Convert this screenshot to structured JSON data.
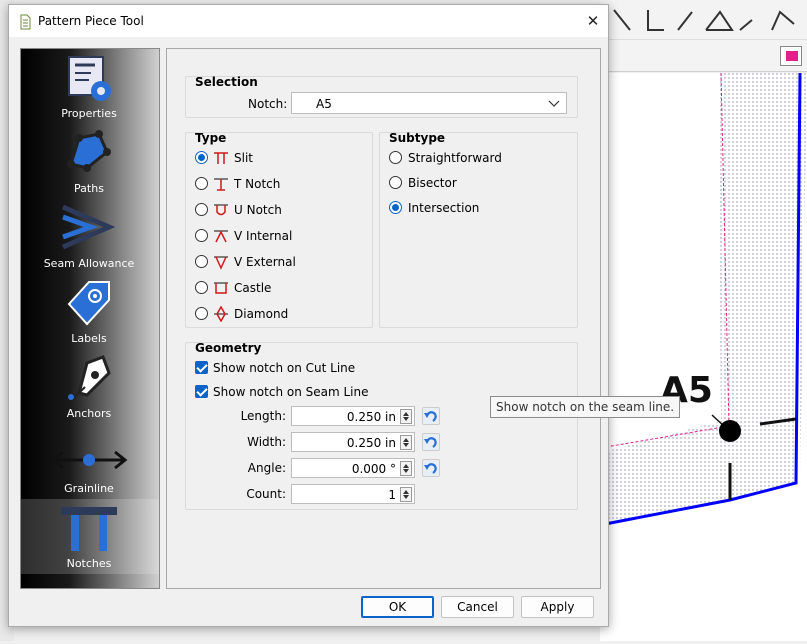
{
  "dialog": {
    "title": "Pattern Piece Tool"
  },
  "sidebar": {
    "items": [
      {
        "label": "Properties",
        "icon": "properties-icon"
      },
      {
        "label": "Paths",
        "icon": "paths-icon"
      },
      {
        "label": "Seam Allowance",
        "icon": "seam-allowance-icon"
      },
      {
        "label": "Labels",
        "icon": "labels-icon"
      },
      {
        "label": "Anchors",
        "icon": "anchors-icon"
      },
      {
        "label": "Grainline",
        "icon": "grainline-icon"
      },
      {
        "label": "Notches",
        "icon": "notches-icon",
        "selected": true
      }
    ]
  },
  "selection": {
    "title": "Selection",
    "notch_label": "Notch:",
    "notch_value": "A5"
  },
  "type": {
    "title": "Type",
    "options": [
      {
        "label": "Slit",
        "checked": true
      },
      {
        "label": "T Notch",
        "checked": false
      },
      {
        "label": "U Notch",
        "checked": false
      },
      {
        "label": "V Internal",
        "checked": false
      },
      {
        "label": "V External",
        "checked": false
      },
      {
        "label": "Castle",
        "checked": false
      },
      {
        "label": "Diamond",
        "checked": false
      }
    ]
  },
  "subtype": {
    "title": "Subtype",
    "options": [
      {
        "label": "Straightforward",
        "checked": false
      },
      {
        "label": "Bisector",
        "checked": false
      },
      {
        "label": "Intersection",
        "checked": true
      }
    ]
  },
  "geometry": {
    "title": "Geometry",
    "show_cut": "Show notch on Cut Line",
    "show_seam": "Show notch on Seam Line",
    "length_label": "Length:",
    "length_value": "0.250 in",
    "width_label": "Width:",
    "width_value": "0.250 in",
    "angle_label": "Angle:",
    "angle_value": "0.000 °",
    "count_label": "Count:",
    "count_value": "1"
  },
  "buttons": {
    "ok": "OK",
    "cancel": "Cancel",
    "apply": "Apply"
  },
  "tooltip": "Show notch on the seam line.",
  "canvas": {
    "point_label": "A5"
  },
  "colors": {
    "accent": "#0a63c9",
    "notch_red": "#d01818",
    "seam_blue": "#0000ff",
    "cut_pink": "#e2208a"
  }
}
